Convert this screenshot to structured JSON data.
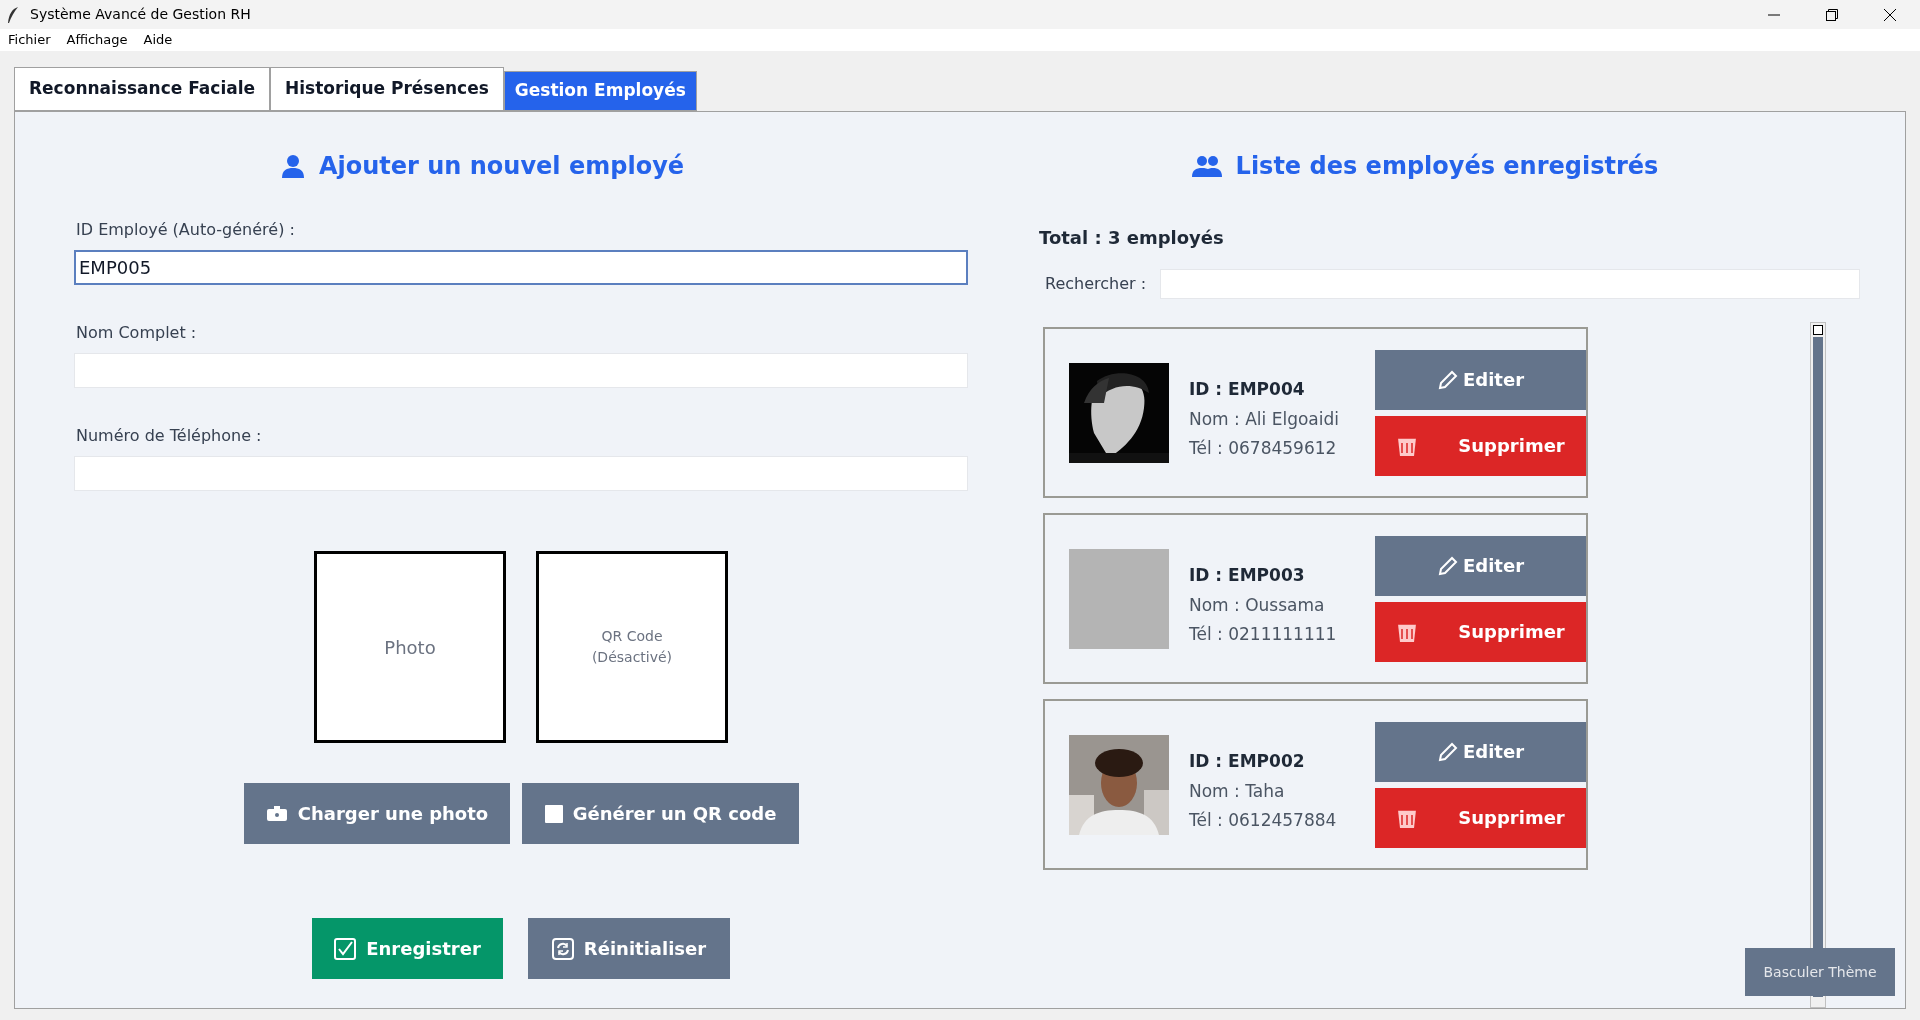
{
  "window": {
    "title": "Système Avancé de Gestion RH"
  },
  "menu": [
    "Fichier",
    "Affichage",
    "Aide"
  ],
  "tabs": [
    {
      "label": "Reconnaissance Faciale",
      "selected": false
    },
    {
      "label": "Historique Présences",
      "selected": false
    },
    {
      "label": "Gestion Employés",
      "selected": true
    }
  ],
  "form": {
    "title": "Ajouter un nouvel employé",
    "fields": [
      {
        "label": "ID Employé (Auto-généré) :",
        "value": "EMP005",
        "focused": true
      },
      {
        "label": "Nom Complet :",
        "focused": false
      },
      {
        "label": "Numéro de Téléphone :",
        "focused": false
      }
    ],
    "photo_box": "Photo",
    "qr_box": "QR Code\n(Désactivé)",
    "buttons": [
      {
        "label": "Charger une photo"
      },
      {
        "label": "Générer un QR code",
        "kind": "qr"
      }
    ],
    "actions": [
      {
        "label": "Enregistrer",
        "kind": "save"
      },
      {
        "label": "Réinitialiser",
        "kind": "reset"
      }
    ]
  },
  "list": {
    "title": "Liste des employés enregistrés",
    "total": "Total : 3 employés",
    "search_label": "Rechercher :",
    "employees": [
      {
        "id": "ID : EMP004",
        "name": "Nom : Ali Elgoaidi",
        "phone": "Tél : 0678459612",
        "edit_label": "Editer",
        "delete_label": "Supprimer"
      },
      {
        "id": "ID : EMP003",
        "name": "Nom : Oussama",
        "phone": "Tél : 0211111111",
        "photo": {
          "kind": "placeholder"
        },
        "edit_label": "Editer",
        "delete_label": "Supprimer"
      },
      {
        "id": "ID : EMP002",
        "name": "Nom : Taha",
        "phone": "Tél : 0612457884",
        "edit_label": "Editer",
        "delete_label": "Supprimer"
      }
    ]
  },
  "theme_button": "Basculer Thème"
}
